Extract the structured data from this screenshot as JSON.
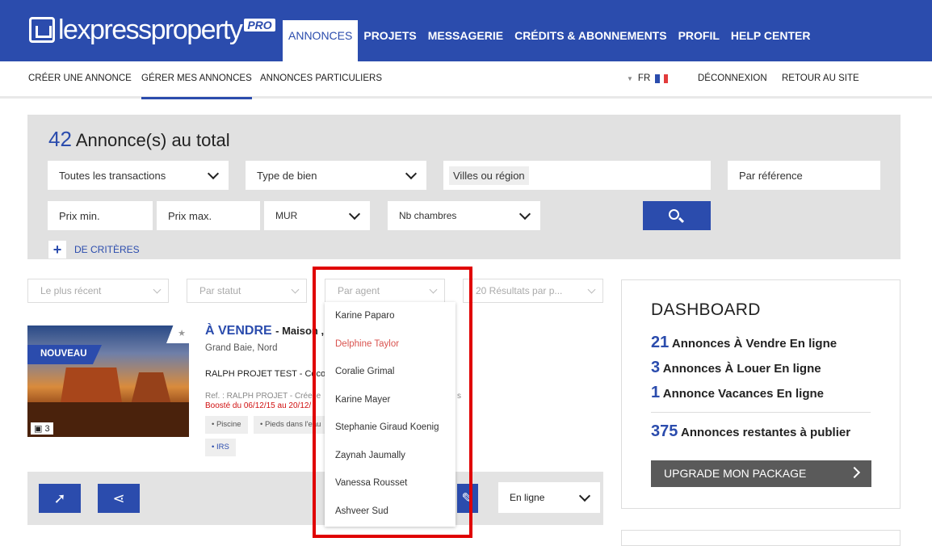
{
  "header": {
    "logo": {
      "brand": "lexpressproperty",
      "badge": "PRO"
    },
    "nav": [
      {
        "label": "ANNONCES",
        "active": true
      },
      {
        "label": "PROJETS"
      },
      {
        "label": "MESSAGERIE"
      },
      {
        "label": "CRÉDITS & ABONNEMENTS"
      },
      {
        "label": "PROFIL"
      },
      {
        "label": "HELP CENTER"
      }
    ]
  },
  "subnav": {
    "items": [
      {
        "label": "CRÉER UNE ANNONCE"
      },
      {
        "label": "GÉRER MES ANNONCES",
        "active": true
      },
      {
        "label": "ANNONCES PARTICULIERS"
      }
    ],
    "lang": "FR",
    "logout": "DÉCONNEXION",
    "back": "RETOUR AU SITE"
  },
  "search": {
    "total_count": "42",
    "total_label": "Annonce(s) au total",
    "transactions": "Toutes les transactions",
    "property_type": "Type de bien",
    "location_placeholder": "Villes ou région",
    "reference_placeholder": "Par référence",
    "price_min": "Prix min.",
    "price_max": "Prix max.",
    "currency": "MUR",
    "bedrooms": "Nb chambres",
    "more_criteria": "DE CRITÈRES"
  },
  "filters": {
    "sort": "Le plus récent",
    "status": "Par statut",
    "agent": "Par agent",
    "per_page": "20 Résultats par p..."
  },
  "agent_dropdown": {
    "options": [
      "Karine Paparo",
      "Delphine Taylor",
      "Coralie Grimal",
      "Karine Mayer",
      "Stephanie Giraud Koenig",
      "Zaynah Jaumally",
      "Vanessa Rousset",
      "Ashveer Sud"
    ],
    "highlighted": "Delphine Taylor"
  },
  "listing": {
    "badge": "NOUVEAU",
    "photo_count": "3",
    "title": "À VENDRE",
    "subtitle": "- Maison ,",
    "location": "Grand Baie, Nord",
    "project": "RALPH PROJET TEST - Coco",
    "ref": "Ref. : RALPH PROJET - Crée le",
    "ref_tail": "s",
    "boost": "Boosté du 06/12/15 au 20/12/",
    "tags": [
      "• Piscine",
      "• Pieds dans l'eau",
      "• IRS"
    ],
    "status_select": "En ligne"
  },
  "dashboard": {
    "title": "DASHBOARD",
    "lines": [
      {
        "count": "21",
        "label": "Annonces À Vendre En ligne"
      },
      {
        "count": "3",
        "label": "Annonces À Louer En ligne"
      },
      {
        "count": "1",
        "label": "Annonce Vacances En ligne"
      }
    ],
    "remaining_count": "375",
    "remaining_label": "Annonces restantes à publier",
    "upgrade": "UPGRADE MON PACKAGE"
  },
  "colors": {
    "brand_blue": "#2b4cad",
    "highlight_red": "#e00000",
    "hover_option": "#d9534f"
  }
}
